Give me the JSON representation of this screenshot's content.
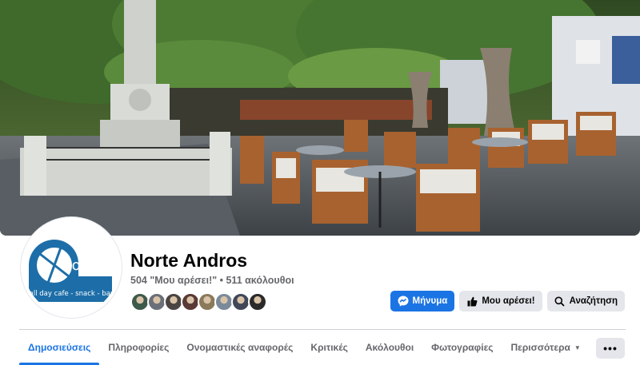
{
  "page": {
    "name": "Norte Andros",
    "stats": "504 \"Μου αρέσει!\" • 511 ακόλουθοι"
  },
  "logo": {
    "name": "Norte",
    "tagline": "all day cafe - snack - bar",
    "accent": "#1d6ea8"
  },
  "actions": {
    "message_label": "Μήνυμα",
    "like_label": "Μου αρέσει!",
    "search_label": "Αναζήτηση"
  },
  "friends": {
    "colors": [
      "#3d5a4a",
      "#6b6f78",
      "#4a4442",
      "#5a3a36",
      "#8a7a5a",
      "#7a8a9a",
      "#404858",
      "#2a2a2a"
    ]
  },
  "tabs": [
    {
      "label": "Δημοσιεύσεις"
    },
    {
      "label": "Πληροφορίες"
    },
    {
      "label": "Ονομαστικές αναφορές"
    },
    {
      "label": "Κριτικές"
    },
    {
      "label": "Ακόλουθοι"
    },
    {
      "label": "Φωτογραφίες"
    },
    {
      "label": "Περισσότερα"
    }
  ],
  "more_button": "•••",
  "colors": {
    "accent": "#1b74e4",
    "secondary_button": "#e4e6eb",
    "muted_text": "#65676b"
  }
}
